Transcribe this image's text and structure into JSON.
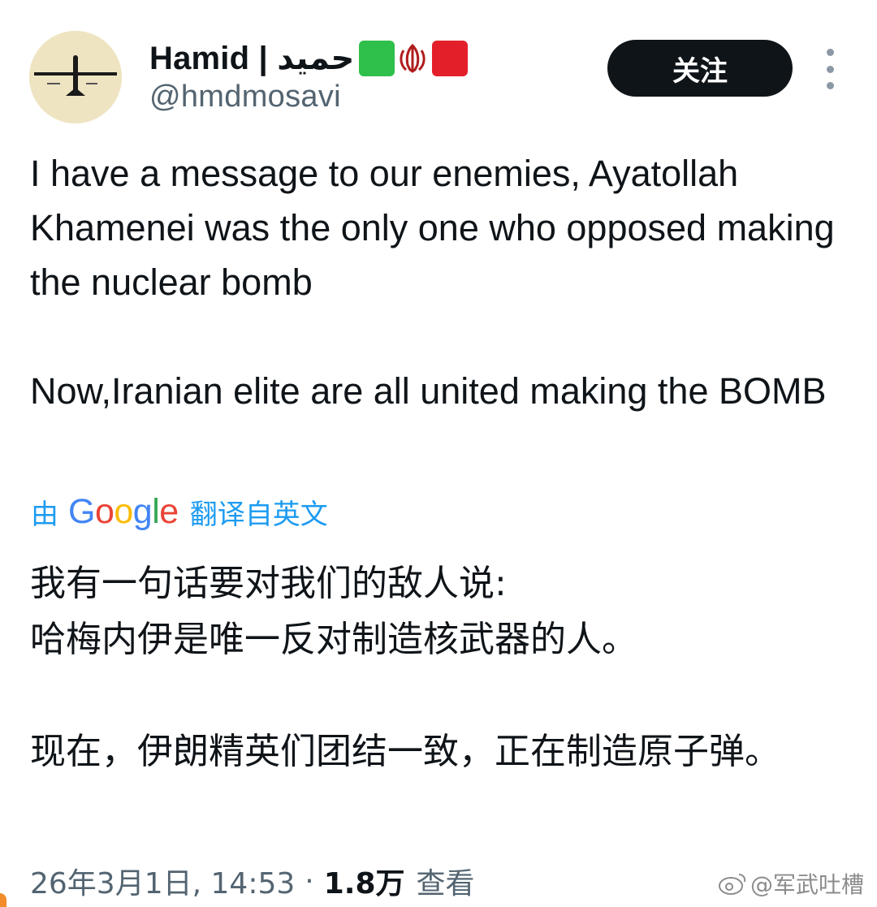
{
  "author": {
    "display_name": "Hamid | حميد",
    "handle": "@hmdmosavi",
    "avatar_icon": "drone-avatar",
    "name_emojis": [
      "green-square-emoji",
      "iran-emblem-emoji",
      "red-square-emoji"
    ]
  },
  "actions": {
    "follow_label": "关注",
    "more_icon": "more-vertical-icon"
  },
  "tweet": {
    "paragraphs": [
      "I have a message to our enemies, Ayatollah Khamenei was the only one who opposed making the nuclear bomb",
      "Now,Iranian elite are all united making the BOMB"
    ]
  },
  "translation": {
    "prefix": "由",
    "provider": "Google",
    "suffix": "翻译自英文",
    "paragraphs": [
      "我有一句话要对我们的敌人说:\n哈梅内伊是唯一反对制造核武器的人。",
      "现在，伊朗精英们团结一致，正在制造原子弹。"
    ]
  },
  "meta": {
    "timestamp": "26年3月1日, 14:53",
    "separator": "·",
    "views_count": "1.8万",
    "views_label": "查看"
  },
  "watermark": {
    "text": "@军武吐槽",
    "icon": "weibo-icon"
  },
  "colors": {
    "link_blue": "#1d9bf0",
    "text_primary": "#0f1419",
    "text_secondary": "#536471",
    "follow_button_bg": "#0f1419",
    "flag_green": "#2fbf4b",
    "flag_red": "#e3202a"
  }
}
